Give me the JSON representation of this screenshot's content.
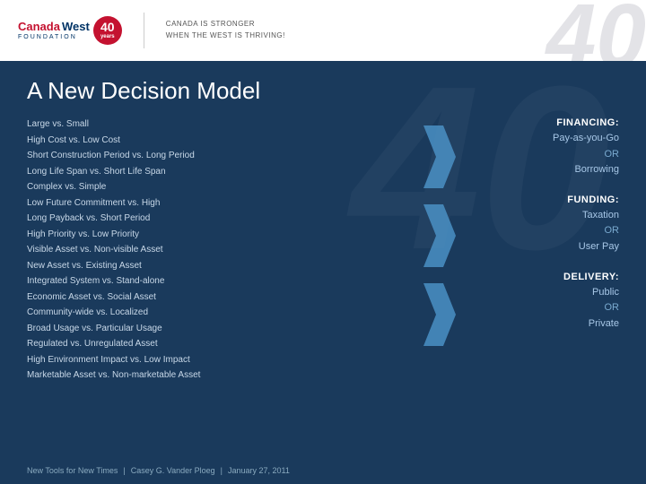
{
  "header": {
    "logo_canada": "Canada",
    "logo_west": "West",
    "logo_foundation": "FOUNDATION",
    "logo_badge_line1": "40",
    "logo_badge_line2": "years",
    "tagline_line1": "CANADA IS STRONGER",
    "tagline_line2": "WHEN THE WEST IS THRIVING!",
    "big_number": "40"
  },
  "page": {
    "title": "A New Decision Model",
    "watermark": "40"
  },
  "left_items": [
    {
      "text": "Large vs. Small"
    },
    {
      "text": "High Cost vs. Low Cost"
    },
    {
      "text": "Short Construction Period vs. Long Period"
    },
    {
      "text": "Long Life Span vs. Short Life Span"
    },
    {
      "text": "Complex vs. Simple"
    },
    {
      "text": "Low Future Commitment vs. High"
    },
    {
      "text": "Long Payback vs. Short Period"
    },
    {
      "text": "High Priority vs. Low Priority"
    },
    {
      "text": "Visible Asset vs. Non-visible Asset"
    },
    {
      "text": "New Asset vs. Existing Asset"
    },
    {
      "text": "Integrated System vs. Stand-alone"
    },
    {
      "text": "Economic Asset vs. Social Asset"
    },
    {
      "text": "Community-wide vs. Localized"
    },
    {
      "text": "Broad Usage vs. Particular Usage"
    },
    {
      "text": "Regulated vs. Unregulated Asset"
    },
    {
      "text": "High Environment Impact vs. Low Impact"
    },
    {
      "text": "Marketable Asset vs. Non-marketable Asset"
    }
  ],
  "financing": {
    "header": "FINANCING:",
    "item1": "Pay-as-you-Go",
    "or1": "OR",
    "item2": "Borrowing"
  },
  "funding": {
    "header": "FUNDING:",
    "item1": "Taxation",
    "or1": "OR",
    "item2": "User Pay"
  },
  "delivery": {
    "header": "DELIVERY:",
    "item1": "Public",
    "or1": "OR",
    "item2": "Private"
  },
  "footer": {
    "part1": "New Tools for New Times",
    "sep1": "|",
    "part2": "Casey G. Vander Ploeg",
    "sep2": "|",
    "part3": "January 27, 2011"
  }
}
